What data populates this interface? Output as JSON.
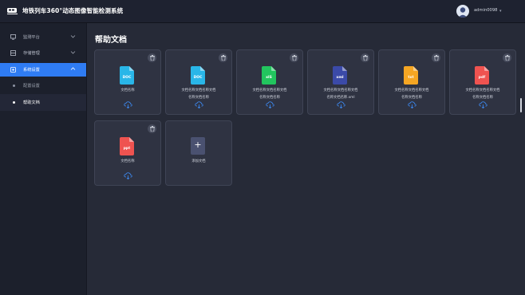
{
  "header": {
    "title": "地铁列车360°动态图像智能检测系统",
    "username": "admin0098"
  },
  "sidebar": {
    "items": [
      {
        "label": "监测平台",
        "icon": "monitor-icon"
      },
      {
        "label": "存储管理",
        "icon": "storage-icon"
      },
      {
        "label": "系统设置",
        "icon": "settings-icon"
      }
    ],
    "subitems": [
      {
        "label": "配置设置"
      },
      {
        "label": "帮助文档"
      }
    ]
  },
  "page": {
    "title": "帮助文档"
  },
  "documents": [
    {
      "ext": "DOC",
      "color": "#29b6e8",
      "name_lines": [
        "文档名称"
      ]
    },
    {
      "ext": "DOC",
      "color": "#29b6e8",
      "name_lines": [
        "文档名称文档名称文档",
        "名称文档名称"
      ]
    },
    {
      "ext": "xlS",
      "color": "#22c55e",
      "name_lines": [
        "文档名称文档名称文档",
        "名称文档名称"
      ]
    },
    {
      "ext": "xml",
      "color": "#3b4aa8",
      "name_lines": [
        "文档名称文档名称文档",
        "名称文档名称.xml"
      ]
    },
    {
      "ext": "txt",
      "color": "#f5a623",
      "name_lines": [
        "文档名称文档名称文档",
        "名称文档名称"
      ]
    },
    {
      "ext": "pdf",
      "color": "#ef5350",
      "name_lines": [
        "文档名称文档名称文档",
        "名称文档名称"
      ]
    },
    {
      "ext": "ppt",
      "color": "#ef5350",
      "name_lines": [
        "文档名称"
      ]
    }
  ],
  "add_card": {
    "symbol": "+",
    "label": "添加文档"
  }
}
